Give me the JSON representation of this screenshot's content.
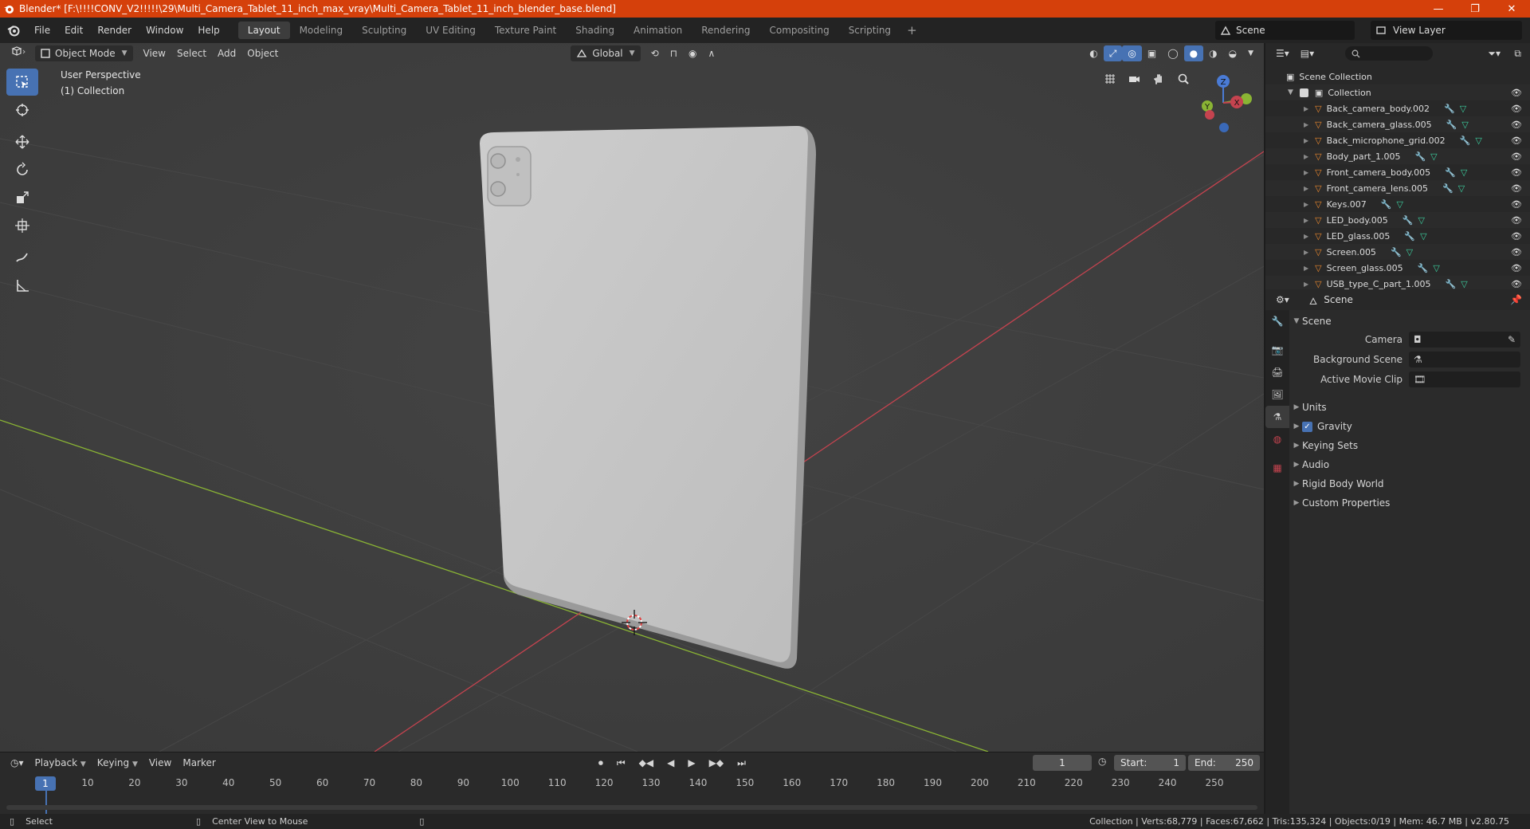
{
  "titlebar": {
    "title": "Blender* [F:\\!!!!CONV_V2!!!!!\\29\\Multi_Camera_Tablet_11_inch_max_vray\\Multi_Camera_Tablet_11_inch_blender_base.blend]"
  },
  "menu": [
    "File",
    "Edit",
    "Render",
    "Window",
    "Help"
  ],
  "workspaces": [
    "Layout",
    "Modeling",
    "Sculpting",
    "UV Editing",
    "Texture Paint",
    "Shading",
    "Animation",
    "Rendering",
    "Compositing",
    "Scripting"
  ],
  "active_workspace": "Layout",
  "scene_selector": "Scene",
  "view_layer_selector": "View Layer",
  "viewport": {
    "mode": "Object Mode",
    "menus": [
      "View",
      "Select",
      "Add",
      "Object"
    ],
    "orientation": "Global",
    "perspective": "User Perspective",
    "collection": "(1) Collection"
  },
  "outliner": {
    "root": "Scene Collection",
    "collection": "Collection",
    "objects": [
      "Back_camera_body.002",
      "Back_camera_glass.005",
      "Back_microphone_grid.002",
      "Body_part_1.005",
      "Front_camera_body.005",
      "Front_camera_lens.005",
      "Keys.007",
      "LED_body.005",
      "LED_glass.005",
      "Screen.005",
      "Screen_glass.005",
      "USB_type_C_part_1.005"
    ]
  },
  "properties": {
    "header": "Scene",
    "panel_title": "Scene",
    "camera_label": "Camera",
    "background_scene_label": "Background Scene",
    "active_movie_clip_label": "Active Movie Clip",
    "subpanels": [
      "Units",
      "Gravity",
      "Keying Sets",
      "Audio",
      "Rigid Body World",
      "Custom Properties"
    ],
    "gravity_checked": true
  },
  "timeline": {
    "menus": [
      "Playback",
      "Keying",
      "View",
      "Marker"
    ],
    "current_frame": "1",
    "start_label": "Start:",
    "start": "1",
    "end_label": "End:",
    "end": "250",
    "ticks": [
      "1",
      "10",
      "20",
      "30",
      "40",
      "50",
      "60",
      "70",
      "80",
      "90",
      "100",
      "110",
      "120",
      "130",
      "140",
      "150",
      "160",
      "170",
      "180",
      "190",
      "200",
      "210",
      "220",
      "230",
      "240",
      "250"
    ]
  },
  "statusbar": {
    "select": "Select",
    "center_view": "Center View to Mouse",
    "stats": "Collection | Verts:68,779 | Faces:67,662 | Tris:135,324 | Objects:0/19 | Mem: 46.7 MB | v2.80.75"
  },
  "colors": {
    "titlebar": "#d5400b",
    "accent": "#4772b3",
    "viewport_bg": "#3d3d3d",
    "x_axis": "#c5434f",
    "y_axis": "#8ab434",
    "tablet": "#c6c6c6"
  }
}
